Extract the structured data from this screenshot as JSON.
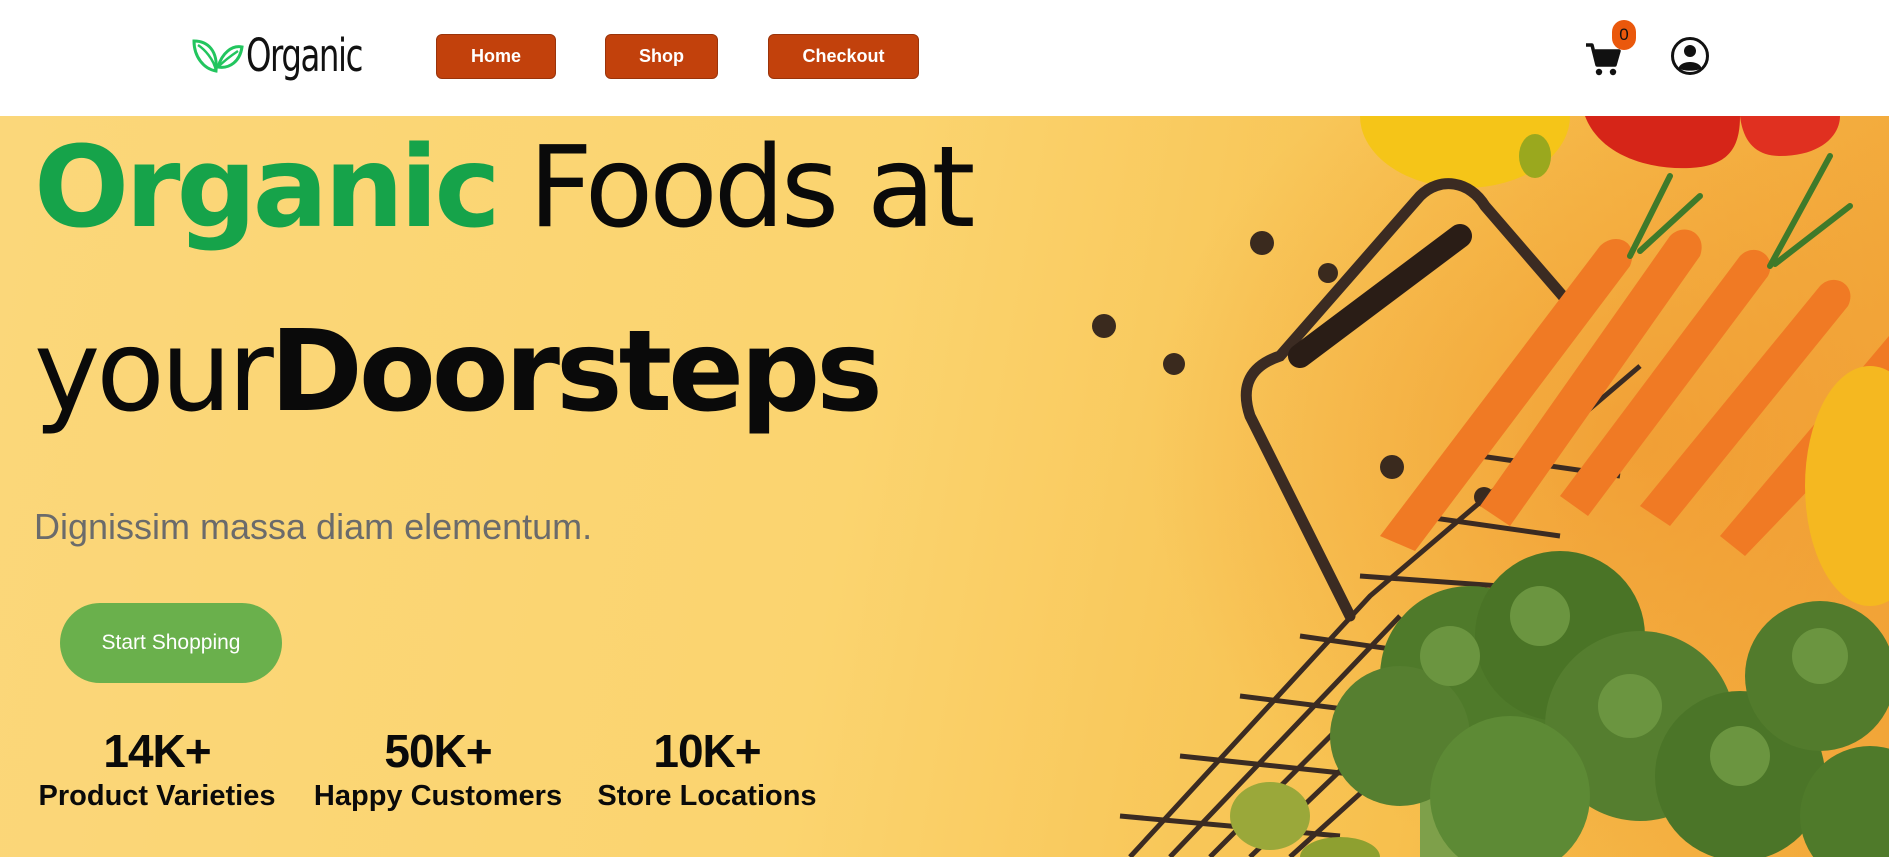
{
  "header": {
    "logo_text": "Organic",
    "logo_icon": "leaf-icon",
    "nav": {
      "home_label": "Home",
      "shop_label": "Shop",
      "checkout_label": "Checkout"
    },
    "cart_icon": "cart-icon",
    "cart_count": "0",
    "user_icon": "user-circle-icon"
  },
  "hero": {
    "headline_line1_accent": "Organic",
    "headline_line1_rest": " Foods at",
    "headline_line2_normal": "your",
    "headline_line2_bold": "Doorsteps",
    "subtitle": "Dignissim massa diam elementum.",
    "cta_label": "Start Shopping",
    "stats": [
      {
        "value": "14K+",
        "label": "Product Varieties"
      },
      {
        "value": "50K+",
        "label": "Happy Customers"
      },
      {
        "value": "10K+",
        "label": "Store Locations"
      }
    ]
  },
  "colors": {
    "brand_green": "#16a34a",
    "nav_button": "#c2410c",
    "cta_green": "#6ab04c",
    "badge": "#ea580c",
    "hero_background": "#fbd77a"
  }
}
